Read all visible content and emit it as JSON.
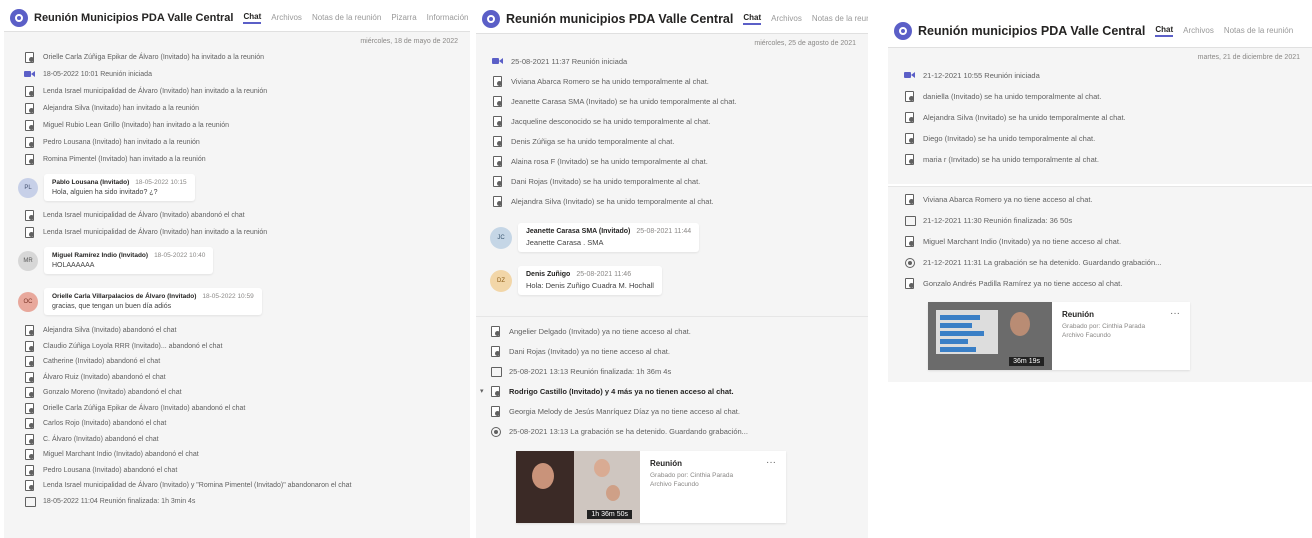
{
  "panel1": {
    "title": "Reunión Municipios PDA Valle Central",
    "tabs": [
      "Chat",
      "Archivos",
      "Notas de la reunión",
      "Pizarra",
      "Información de la reunión"
    ],
    "date": "miércoles, 18 de mayo de 2022",
    "events_top": [
      {
        "icon": "person",
        "text": "Orielle Carla Zúñiga Epikar de Álvaro (Invitado) ha invitado a la reunión"
      },
      {
        "icon": "video",
        "text": "18-05-2022 10:01 Reunión iniciada"
      },
      {
        "icon": "person",
        "text": "Lenda Israel municipalidad de Álvaro (Invitado) han invitado a la reunión"
      },
      {
        "icon": "person",
        "text": "Alejandra Silva (Invitado) han invitado a la reunión"
      },
      {
        "icon": "person",
        "text": "Miguel Rubio Lean Grillo (Invitado) han invitado a la reunión"
      },
      {
        "icon": "person",
        "text": "Pedro Lousana (Invitado) han invitado a la reunión"
      },
      {
        "icon": "person",
        "text": "Romina Pimentel (Invitado) han invitado a la reunión"
      }
    ],
    "msg1": {
      "name": "Pablo Lousana (Invitado)",
      "time": "18-05-2022 10:15",
      "text": "Hola, alguien ha sido invitado? ¿?"
    },
    "events_mid": [
      {
        "icon": "person",
        "text": "Lenda Israel municipalidad de Álvaro (Invitado) abandonó el chat"
      },
      {
        "icon": "person",
        "text": "Lenda Israel municipalidad de Álvaro (Invitado) han invitado a la reunión"
      }
    ],
    "msg2": {
      "name": "Miguel Ramírez Indio (Invitado)",
      "time": "18-05-2022 10:40",
      "text": "HOLAAAAAA"
    },
    "msg3": {
      "name": "Orielle Carla Villarpalacios de Álvaro (Invitado)",
      "time": "18-05-2022 10:59",
      "text": "gracias, que tengan un buen día adiós"
    },
    "events_bottom": [
      {
        "icon": "person",
        "text": "Alejandra Silva (Invitado) abandonó el chat"
      },
      {
        "icon": "person",
        "text": "Claudio Zúñiga Loyola RRR (Invitado)... abandonó el chat"
      },
      {
        "icon": "person",
        "text": "Catherine (Invitado) abandonó el chat"
      },
      {
        "icon": "person",
        "text": "Álvaro Ruiz (Invitado) abandonó el chat"
      },
      {
        "icon": "person",
        "text": "Gonzalo Moreno (Invitado) abandonó el chat"
      },
      {
        "icon": "person",
        "text": "Orielle Carla Zúñiga Epikar de Álvaro (Invitado) abandonó el chat"
      },
      {
        "icon": "person",
        "text": "Carlos Rojo (Invitado) abandonó el chat"
      },
      {
        "icon": "person",
        "text": "C. Álvaro (Invitado) abandonó el chat"
      },
      {
        "icon": "person",
        "text": "Miguel Marchant Indio (Invitado) abandonó el chat"
      },
      {
        "icon": "person",
        "text": "Pedro Lousana (Invitado) abandonó el chat"
      },
      {
        "icon": "person",
        "text": "Lenda Israel municipalidad de Álvaro (Invitado) y \"Romina Pimentel (Invitado)\" abandonaron el chat"
      },
      {
        "icon": "cal",
        "text": "18-05-2022 11:04 Reunión finalizada: 1h 3min 4s"
      }
    ]
  },
  "panel2": {
    "title": "Reunión municipios PDA Valle Central",
    "tabs": [
      "Chat",
      "Archivos",
      "Notas de la reunión"
    ],
    "date": "miércoles, 25 de agosto de 2021",
    "events_top": [
      {
        "icon": "video",
        "text": "25-08-2021 11:37   Reunión iniciada"
      },
      {
        "icon": "person",
        "text": "Viviana Abarca Romero se ha unido temporalmente al chat."
      },
      {
        "icon": "person",
        "text": "Jeanette Carasa SMA (Invitado) se ha unido temporalmente al chat."
      },
      {
        "icon": "person",
        "text": "Jacqueline desconocido se ha unido temporalmente al chat."
      },
      {
        "icon": "person",
        "text": "Denis Zúñiga se ha unido temporalmente al chat."
      },
      {
        "icon": "person",
        "text": "Alaina rosa F (Invitado) se ha unido temporalmente al chat."
      },
      {
        "icon": "person",
        "text": "Dani Rojas (Invitado) se ha unido temporalmente al chat."
      },
      {
        "icon": "person",
        "text": "Alejandra Silva (Invitado) se ha unido temporalmente al chat."
      }
    ],
    "msg1": {
      "name": "Jeanette Carasa SMA (Invitado)",
      "time": "25-08-2021 11:44",
      "text": "Jeanette Carasa . SMA",
      "avatar": "JC"
    },
    "msg2": {
      "name": "Denis Zuñigo",
      "time": "25-08-2021 11:46",
      "text": "Hola: Denis Zuñigo Cuadra M. Hochall",
      "avatar": "DZ"
    }
  },
  "panel2b": {
    "events": [
      {
        "icon": "person",
        "text": "Angelier Delgado (Invitado) ya no tiene acceso al chat.",
        "bold": false
      },
      {
        "icon": "person",
        "text": "Dani Rojas (Invitado) ya no tiene acceso al chat.",
        "bold": false
      },
      {
        "icon": "cal",
        "text": "25-08-2021 13:13    Reunión finalizada: 1h 36m 4s",
        "bold": false
      },
      {
        "icon": "person",
        "text": "Rodrigo Castillo (Invitado) y 4 más ya no tienen acceso al chat.",
        "bold": true
      },
      {
        "icon": "person",
        "text": "Georgia Melody de Jesús Manríquez Díaz ya no tiene acceso al chat.",
        "bold": false
      },
      {
        "icon": "rec",
        "text": "25-08-2021 13:13    La grabación se ha detenido. Guardando grabación...",
        "bold": false
      }
    ],
    "card": {
      "title": "Reunión",
      "sub1": "Grabado por: Cinthia Parada",
      "sub2": "Archivo Facundo",
      "thumb_label": "1h 36m 50s",
      "menu": "···"
    }
  },
  "panel3": {
    "title": "Reunión municipios PDA Valle Central",
    "tabs": [
      "Chat",
      "Archivos",
      "Notas de la reunión"
    ],
    "date": "martes, 21 de diciembre de 2021",
    "events": [
      {
        "icon": "video",
        "text": "21-12-2021 10:55   Reunión iniciada"
      },
      {
        "icon": "person",
        "text": "daniella (Invitado) se ha unido temporalmente al chat."
      },
      {
        "icon": "person",
        "text": "Alejandra Silva (Invitado) se ha unido temporalmente al chat."
      },
      {
        "icon": "person",
        "text": "Diego (Invitado) se ha unido temporalmente al chat."
      },
      {
        "icon": "person",
        "text": "maria r (Invitado) se ha unido temporalmente al chat."
      }
    ]
  },
  "panel3b": {
    "events": [
      {
        "icon": "person",
        "text": "Viviana Abarca Romero ya no tiene acceso al chat."
      },
      {
        "icon": "cal",
        "text": "21-12-2021 11:30    Reunión finalizada: 36 50s"
      },
      {
        "icon": "person",
        "text": "Miguel Marchant Indio (Invitado) ya no tiene acceso al chat."
      },
      {
        "icon": "rec",
        "text": "21-12-2021 11:31    La grabación se ha detenido. Guardando grabación..."
      },
      {
        "icon": "person",
        "text": "Gonzalo Andrés Padilla Ramírez ya no tiene acceso al chat."
      }
    ],
    "card": {
      "title": "Reunión",
      "sub1": "Grabado por: Cinthia Parada",
      "sub2": "Archivo Facundo",
      "thumb_label": "36m 19s",
      "menu": "···"
    }
  }
}
